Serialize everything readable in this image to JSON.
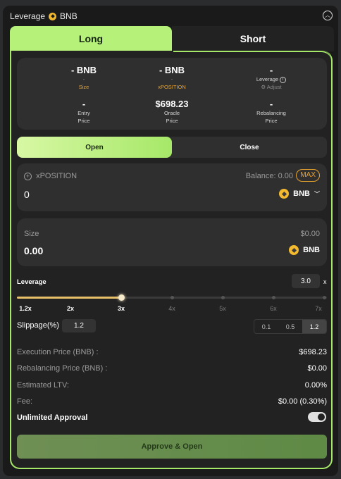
{
  "header": {
    "title": "Leverage",
    "asset": "BNB"
  },
  "tabs": [
    {
      "label": "Long",
      "active": true
    },
    {
      "label": "Short",
      "active": false
    }
  ],
  "summary": {
    "size": {
      "value": "- BNB",
      "sub": "-",
      "label": "Size"
    },
    "xposition": {
      "value": "- BNB",
      "sub": "-",
      "label": "xPOSITION"
    },
    "leverage": {
      "value": "-",
      "label": "Leverage",
      "action": "Adjust"
    },
    "entry": {
      "value": "-",
      "label1": "Entry",
      "label2": "Price"
    },
    "oracle": {
      "value": "$698.23",
      "label1": "Oracle",
      "label2": "Price"
    },
    "rebalancing": {
      "value": "-",
      "label1": "Rebalancing",
      "label2": "Price"
    }
  },
  "mode": {
    "open": "Open",
    "close": "Close"
  },
  "input": {
    "label": "xPOSITION",
    "balance": "Balance: 0.00",
    "max": "MAX",
    "amount": "0",
    "token": "BNB"
  },
  "size_box": {
    "label": "Size",
    "usd": "$0.00",
    "amount": "0.00",
    "token": "BNB"
  },
  "leverage": {
    "label": "Leverage",
    "value": "3.0",
    "unit": "x",
    "ticks": [
      "1.2x",
      "2x",
      "3x",
      "4x",
      "5x",
      "6x",
      "7x"
    ],
    "min": 1.2,
    "max": 7,
    "current": 3.0
  },
  "slippage": {
    "label": "Slippage(%)",
    "value": "1.2",
    "options": [
      "0.1",
      "0.5",
      "1.2"
    ],
    "selected": "1.2"
  },
  "details": [
    {
      "k": "Execution Price (BNB) :",
      "v": "$698.23"
    },
    {
      "k": "Rebalancing Price (BNB) :",
      "v": "$0.00"
    },
    {
      "k": "Estimated LTV:",
      "v": "0.00%"
    },
    {
      "k": "Fee:",
      "v": "$0.00 (0.30%)"
    }
  ],
  "approval": {
    "label": "Unlimited Approval",
    "enabled": true
  },
  "cta": {
    "label": "Approve & Open"
  },
  "colors": {
    "accent": "#a6e868",
    "orange": "#e8a32f",
    "bnb": "#f3ba2f"
  }
}
